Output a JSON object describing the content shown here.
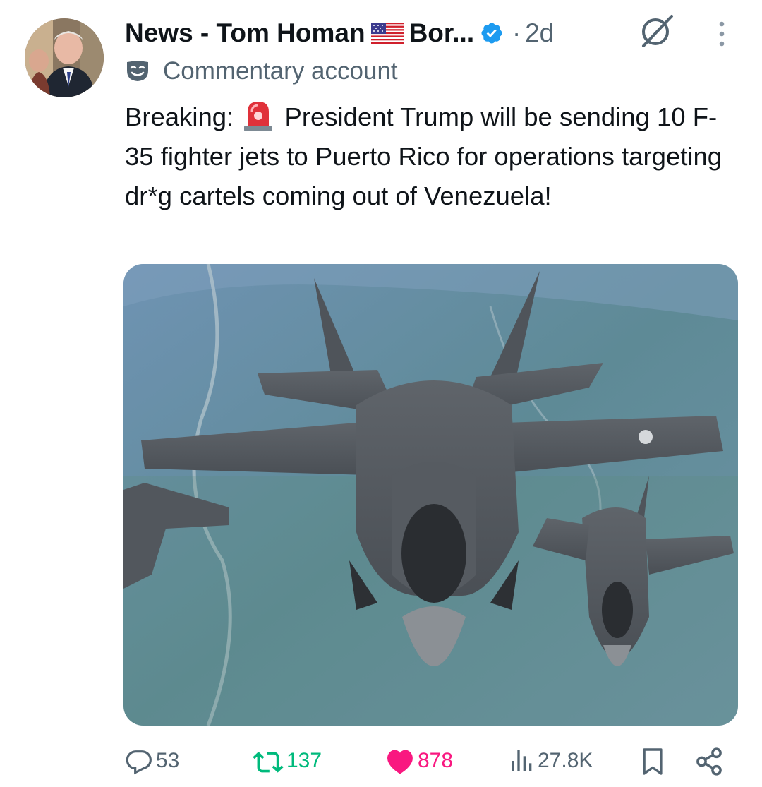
{
  "post": {
    "author_name": "News - Tom Homan",
    "author_suffix": "Bor...",
    "separator": "·",
    "time": "2d",
    "label": "Commentary account",
    "text_before_emoji": "Breaking: ",
    "text_after_emoji": " President Trump will be sending 10 F-35 fighter jets to Puerto Rico for operations targeting dr*g cartels coming out of Venezuela!",
    "emoji": "siren",
    "image_subject": "F-35 fighter jets in formation over terrain"
  },
  "actions": {
    "replies": "53",
    "reposts": "137",
    "likes": "878",
    "views": "27.8K"
  },
  "colors": {
    "verified": "#1d9bf0",
    "repost": "#00ba7c",
    "like": "#f91880",
    "muted": "#536471"
  },
  "icons": [
    "reply-icon",
    "repost-icon",
    "like-icon",
    "views-icon",
    "bookmark-icon",
    "share-icon",
    "grok-icon",
    "more-icon",
    "verified-icon",
    "commentary-mask-icon",
    "us-flag-icon",
    "siren-icon"
  ]
}
